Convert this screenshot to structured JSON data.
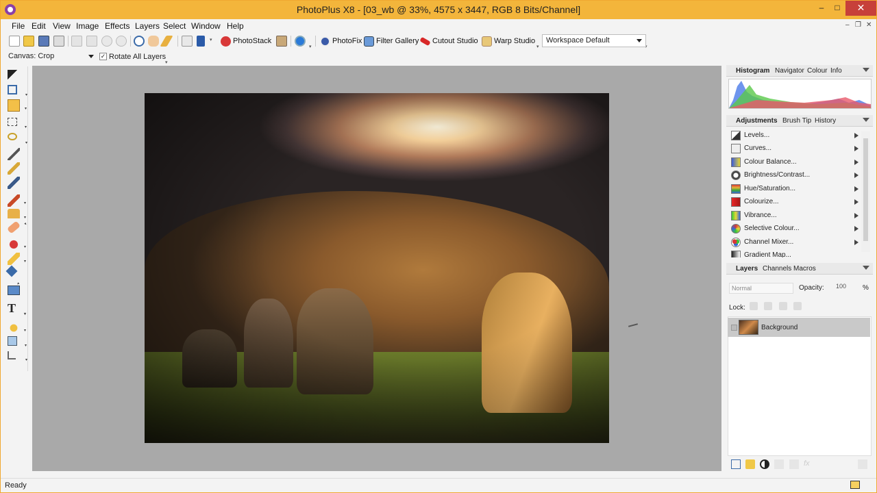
{
  "window": {
    "title": "PhotoPlus X8 - [03_wb @ 33%, 4575 x 3447, RGB 8 Bits/Channel]",
    "min": "–",
    "max": "□",
    "close": "✕"
  },
  "menu": [
    "File",
    "Edit",
    "View",
    "Image",
    "Effects",
    "Layers",
    "Select",
    "Window",
    "Help"
  ],
  "mdi": [
    "–",
    "❐",
    "✕"
  ],
  "toolbar": {
    "photostack": "PhotoStack",
    "photofix": "PhotoFix",
    "filter_gallery": "Filter Gallery",
    "cutout_studio": "Cutout Studio",
    "warp_studio": "Warp Studio",
    "workspace": "Workspace Default"
  },
  "context": {
    "canvas": "Canvas: Crop",
    "rotate_label": "Rotate All Layers",
    "rotate_checked": "✓"
  },
  "status": {
    "text": "Ready"
  },
  "panels": {
    "top_tabs": [
      "Histogram",
      "Navigator",
      "Colour",
      "Info"
    ],
    "mid_tabs": [
      "Adjustments",
      "Brush Tip",
      "History"
    ],
    "adjustments": [
      "Levels...",
      "Curves...",
      "Colour Balance...",
      "Brightness/Contrast...",
      "Hue/Saturation...",
      "Colourize...",
      "Vibrance...",
      "Selective Colour...",
      "Channel Mixer...",
      "Gradient Map..."
    ],
    "layer_tabs": [
      "Layers",
      "Channels",
      "Macros"
    ],
    "blend_mode": "Normal",
    "opacity_label": "Opacity:",
    "opacity_value": "100",
    "opacity_unit": "%",
    "lock_label": "Lock:",
    "layer_name": "Background"
  },
  "tools_text_glyph": "T"
}
